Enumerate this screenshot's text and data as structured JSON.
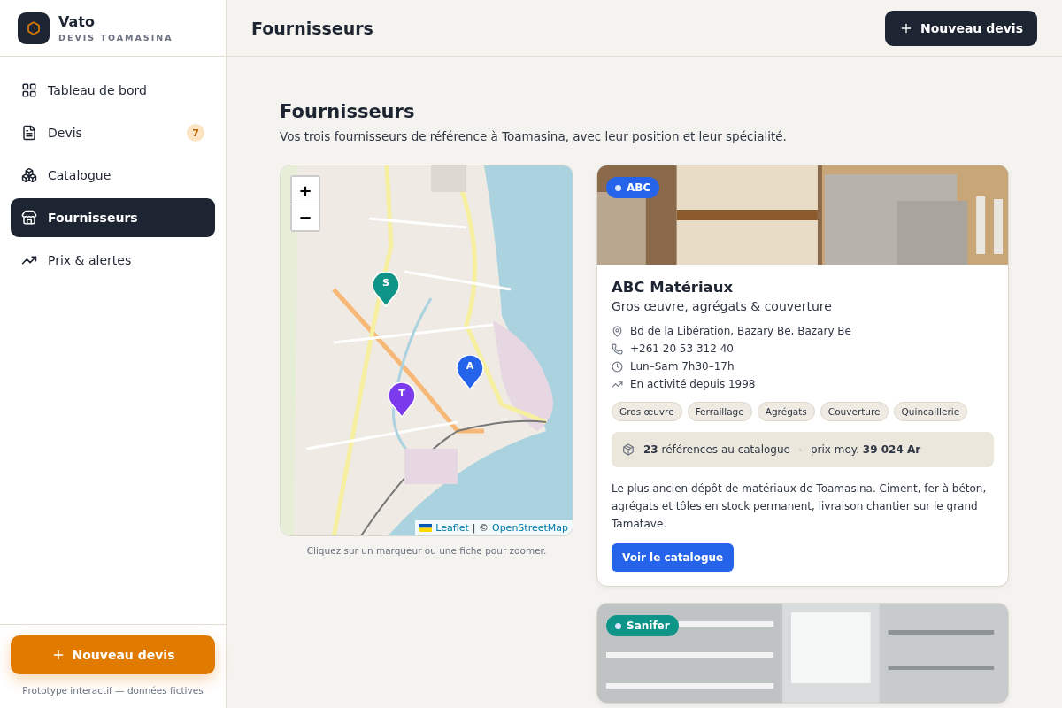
{
  "brand": {
    "name": "Vato",
    "subtitle": "DEVIS TOAMASINA"
  },
  "nav": [
    {
      "kind": "dashboard",
      "label": "Tableau de bord",
      "selected": false
    },
    {
      "kind": "quotes",
      "label": "Devis",
      "badge": "7",
      "selected": false
    },
    {
      "kind": "catalogue",
      "label": "Catalogue",
      "selected": false
    },
    {
      "kind": "suppliers",
      "label": "Fournisseurs",
      "selected": true
    },
    {
      "kind": "prices",
      "label": "Prix & alertes",
      "selected": false
    }
  ],
  "sidebar_button": "Nouveau devis",
  "sidebar_footer": "Prototype interactif — données fictives",
  "header": {
    "title": "Fournisseurs",
    "button": "Nouveau devis"
  },
  "page": {
    "title": "Fournisseurs",
    "subtitle": "Vos trois fournisseurs de référence à Toamasina, avec leur position et leur spécialité."
  },
  "map": {
    "zoom_in": "+",
    "zoom_out": "−",
    "attribution_link": "Leaflet",
    "attribution_sep": "| ©",
    "attribution_osm": "OpenStreetMap",
    "caption": "Cliquez sur un marqueur ou une fiche pour zoomer.",
    "markers": [
      {
        "letter": "S",
        "color": "#0f9488"
      },
      {
        "letter": "A",
        "color": "#2563eb"
      },
      {
        "letter": "T",
        "color": "#7c3aed"
      }
    ]
  },
  "suppliers": [
    {
      "badge": "ABC",
      "color": "#2563eb",
      "name": "ABC Matériaux",
      "specialty": "Gros œuvre, agrégats & couverture",
      "details": [
        {
          "kind": "address",
          "text": "Bd de la Libération, Bazary Be, Bazary Be"
        },
        {
          "kind": "phone",
          "text": "+261 20 53 312 40"
        },
        {
          "kind": "hours",
          "text": "Lun–Sam 7h30–17h"
        },
        {
          "kind": "since",
          "text": "En activité depuis 1998"
        }
      ],
      "tags": [
        "Gros œuvre",
        "Ferraillage",
        "Agrégats",
        "Couverture",
        "Quincaillerie"
      ],
      "refs": "**23** références au catalogue",
      "price": "prix moy. **39 024 Ar**",
      "description": "Le plus ancien dépôt de matériaux de Toamasina. Ciment, fer à béton, agrégats et tôles en stock permanent, livraison chantier sur le grand Tamatave.",
      "button": "Voir le catalogue"
    },
    {
      "badge": "Sanifer",
      "color": "#0f9488"
    }
  ]
}
